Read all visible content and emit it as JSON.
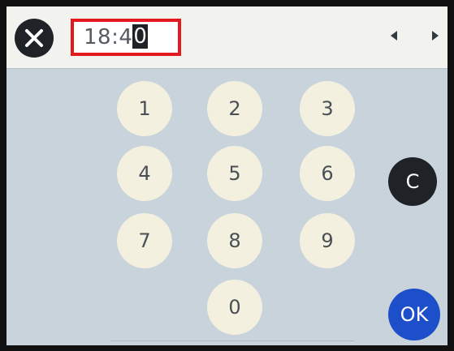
{
  "header": {
    "close_icon": "close-icon",
    "time_text": "18:4",
    "cursor_char": "0",
    "field_border_color": "#e3191d",
    "nav_left_icon": "arrow-left-icon",
    "nav_right_icon": "arrow-right-icon"
  },
  "keypad": {
    "keys": [
      "1",
      "2",
      "3",
      "4",
      "5",
      "6",
      "7",
      "8",
      "9",
      "0"
    ],
    "clear_label": "C",
    "ok_label": "OK"
  },
  "colors": {
    "key_face": "#f3f0df",
    "screen_bg": "#c8d3dc",
    "dark_button": "#1f2327",
    "ok_button": "#1c4fc9"
  }
}
